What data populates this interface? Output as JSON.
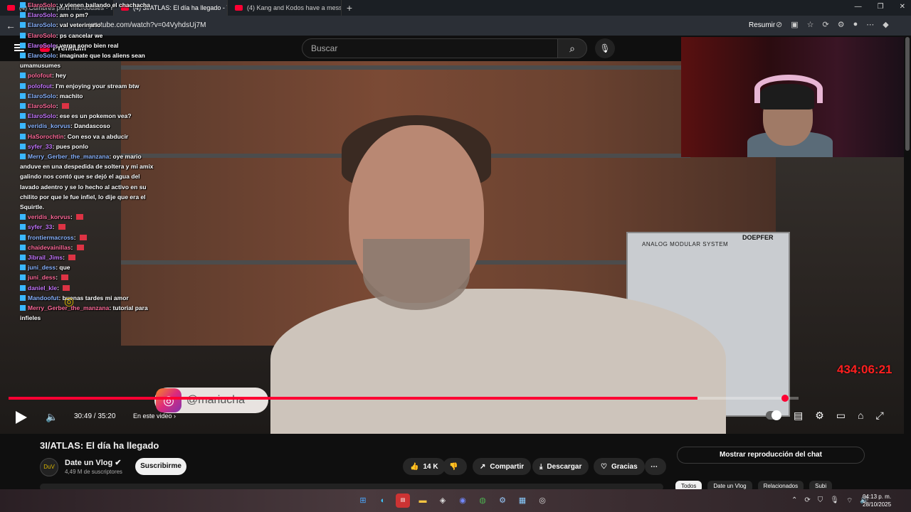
{
  "browser": {
    "tabs": [
      {
        "label": "(4) Cumbres para microbuses - Y"
      },
      {
        "label": "(4) 3I/ATLAS: El día ha llegado - Y"
      },
      {
        "label": "(4) Kang and Kodos have a messa"
      }
    ],
    "url": "youtube.com/watch?v=04VyhdsUj7M",
    "resumir_label": "Resumir"
  },
  "youtube": {
    "logo_text": "Premium",
    "search_placeholder": "Buscar"
  },
  "chat": {
    "messages": [
      {
        "user": "ElaroSolo",
        "text": "y vienen bailando el chachacha"
      },
      {
        "user": "ElaroSolo",
        "text": "am o pm?"
      },
      {
        "user": "ElaroSolo",
        "text": "val veterinario"
      },
      {
        "user": "ElaroSolo",
        "text": "ps cancelar we"
      },
      {
        "user": "ElaroSolo",
        "text": "verga sono bien real"
      },
      {
        "user": "ElaroSolo",
        "text": "imaginate que los aliens sean umamusumes"
      },
      {
        "user": "polofout",
        "text": "hey"
      },
      {
        "user": "polofout",
        "text": "I'm enjoying your stream btw"
      },
      {
        "user": "ElaroSolo",
        "text": "machito"
      },
      {
        "user": "ElaroSolo",
        "text": ""
      },
      {
        "user": "ElaroSolo",
        "text": "ese es un pokemon vea?"
      },
      {
        "user": "veridis_korvus",
        "text": "Dandascoso"
      },
      {
        "user": "HaSorochtin",
        "text": "Con eso va a abducir"
      },
      {
        "user": "syfer_33",
        "text": "pues ponlo"
      },
      {
        "user": "Merry_Gerber_the_manzana",
        "text": "oye mario anduve en una despedida de soltera y mi amix galindo nos contó que se dejó el agua del lavado adentro y se lo hecho al activo en su chilito por que le fue infiel, lo dije que era el Squirtle."
      },
      {
        "user": "veridis_korvus",
        "text": ""
      },
      {
        "user": "syfer_33",
        "text": ""
      },
      {
        "user": "frontiermacross",
        "text": ""
      },
      {
        "user": "chaidevainillas",
        "text": ""
      },
      {
        "user": "Jibrail_Jims",
        "text": ""
      },
      {
        "user": "juni_dess",
        "text": "que"
      },
      {
        "user": "juni_dess",
        "text": ""
      },
      {
        "user": "daniel_kle",
        "text": ""
      },
      {
        "user": "Mandoofut",
        "text": "buenas tardes mi amor"
      },
      {
        "user": "Merry_Gerber_the_manzana",
        "text": "tutorial para infieles"
      }
    ]
  },
  "overlay": {
    "timer": "434:06:21",
    "synth_label": "ANALOG MODULAR SYSTEM",
    "synth_brand": "DOEPFER",
    "instagram_handle": "@mariucha"
  },
  "player": {
    "time": "30:49 / 35:20",
    "chapter_label": "En este video",
    "progress_fraction": 0.872
  },
  "video": {
    "title": "3I/ATLAS: El día ha llegado",
    "channel": "Date un Vlog",
    "subscribers": "4,49 M de suscriptores",
    "subscribe_label": "Suscribirme",
    "likes": "14 K",
    "share_label": "Compartir",
    "download_label": "Descargar",
    "thanks_label": "Gracias",
    "chat_replay_label": "Mostrar reproducción del chat",
    "filters": [
      "Todos",
      "Date un Vlog",
      "Relacionados",
      "Subi"
    ]
  },
  "taskbar": {
    "time": "04:13 p. m.",
    "date": "28/10/2025"
  }
}
